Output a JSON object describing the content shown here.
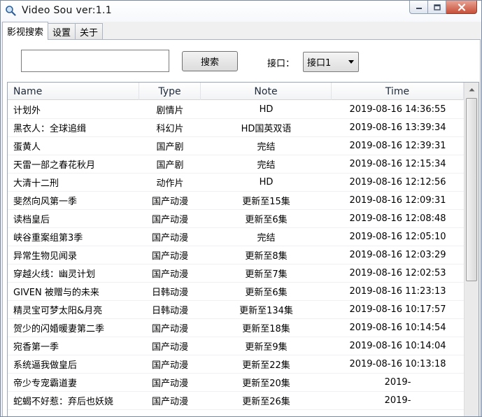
{
  "window": {
    "title": "Video Sou  ver:1.1"
  },
  "tabs": [
    {
      "label": "影视搜索",
      "active": true
    },
    {
      "label": "设置",
      "active": false
    },
    {
      "label": "关于",
      "active": false
    }
  ],
  "search": {
    "value": "",
    "button_label": "搜索"
  },
  "interface": {
    "label": "接口：",
    "selected": "接口1"
  },
  "table": {
    "columns": {
      "name": "Name",
      "type": "Type",
      "note": "Note",
      "time": "Time"
    },
    "rows": [
      {
        "name": "计划外",
        "type": "剧情片",
        "note": "HD",
        "time": "2019-08-16 14:36:55"
      },
      {
        "name": "黑衣人：全球追缉",
        "type": "科幻片",
        "note": "HD国英双语",
        "time": "2019-08-16 13:39:34"
      },
      {
        "name": "蛋黄人",
        "type": "国产剧",
        "note": "完结",
        "time": "2019-08-16 12:39:31"
      },
      {
        "name": "天雷一部之春花秋月",
        "type": "国产剧",
        "note": "完结",
        "time": "2019-08-16 12:15:34"
      },
      {
        "name": "大清十二刑",
        "type": "动作片",
        "note": "HD",
        "time": "2019-08-16 12:12:56"
      },
      {
        "name": "斐然向风第一季",
        "type": "国产动漫",
        "note": "更新至15集",
        "time": "2019-08-16 12:09:31"
      },
      {
        "name": "读档皇后",
        "type": "国产动漫",
        "note": "更新至6集",
        "time": "2019-08-16 12:08:48"
      },
      {
        "name": "峡谷重案组第3季",
        "type": "国产动漫",
        "note": "完结",
        "time": "2019-08-16 12:05:10"
      },
      {
        "name": "异常生物见闻录",
        "type": "国产动漫",
        "note": "更新至8集",
        "time": "2019-08-16 12:03:29"
      },
      {
        "name": "穿越火线：幽灵计划",
        "type": "国产动漫",
        "note": "更新至7集",
        "time": "2019-08-16 12:02:53"
      },
      {
        "name": "GIVEN 被赠与的未来",
        "type": "日韩动漫",
        "note": "更新至6集",
        "time": "2019-08-16 11:23:13"
      },
      {
        "name": "精灵宝可梦太阳&月亮",
        "type": "日韩动漫",
        "note": "更新至134集",
        "time": "2019-08-16 10:17:57"
      },
      {
        "name": "贺少的闪婚暖妻第二季",
        "type": "国产动漫",
        "note": "更新至18集",
        "time": "2019-08-16 10:14:54"
      },
      {
        "name": "宛香第一季",
        "type": "国产动漫",
        "note": "更新至9集",
        "time": "2019-08-16 10:14:04"
      },
      {
        "name": "系统逼我做皇后",
        "type": "国产动漫",
        "note": "更新至22集",
        "time": "2019-08-16 10:13:18"
      },
      {
        "name": "帝少专宠霸道妻",
        "type": "国产动漫",
        "note": "更新至20集",
        "time": "2019-"
      },
      {
        "name": "蛇蝎不好惹：弃后也妖娆",
        "type": "国产动漫",
        "note": "更新至26集",
        "time": "2019-"
      }
    ]
  }
}
